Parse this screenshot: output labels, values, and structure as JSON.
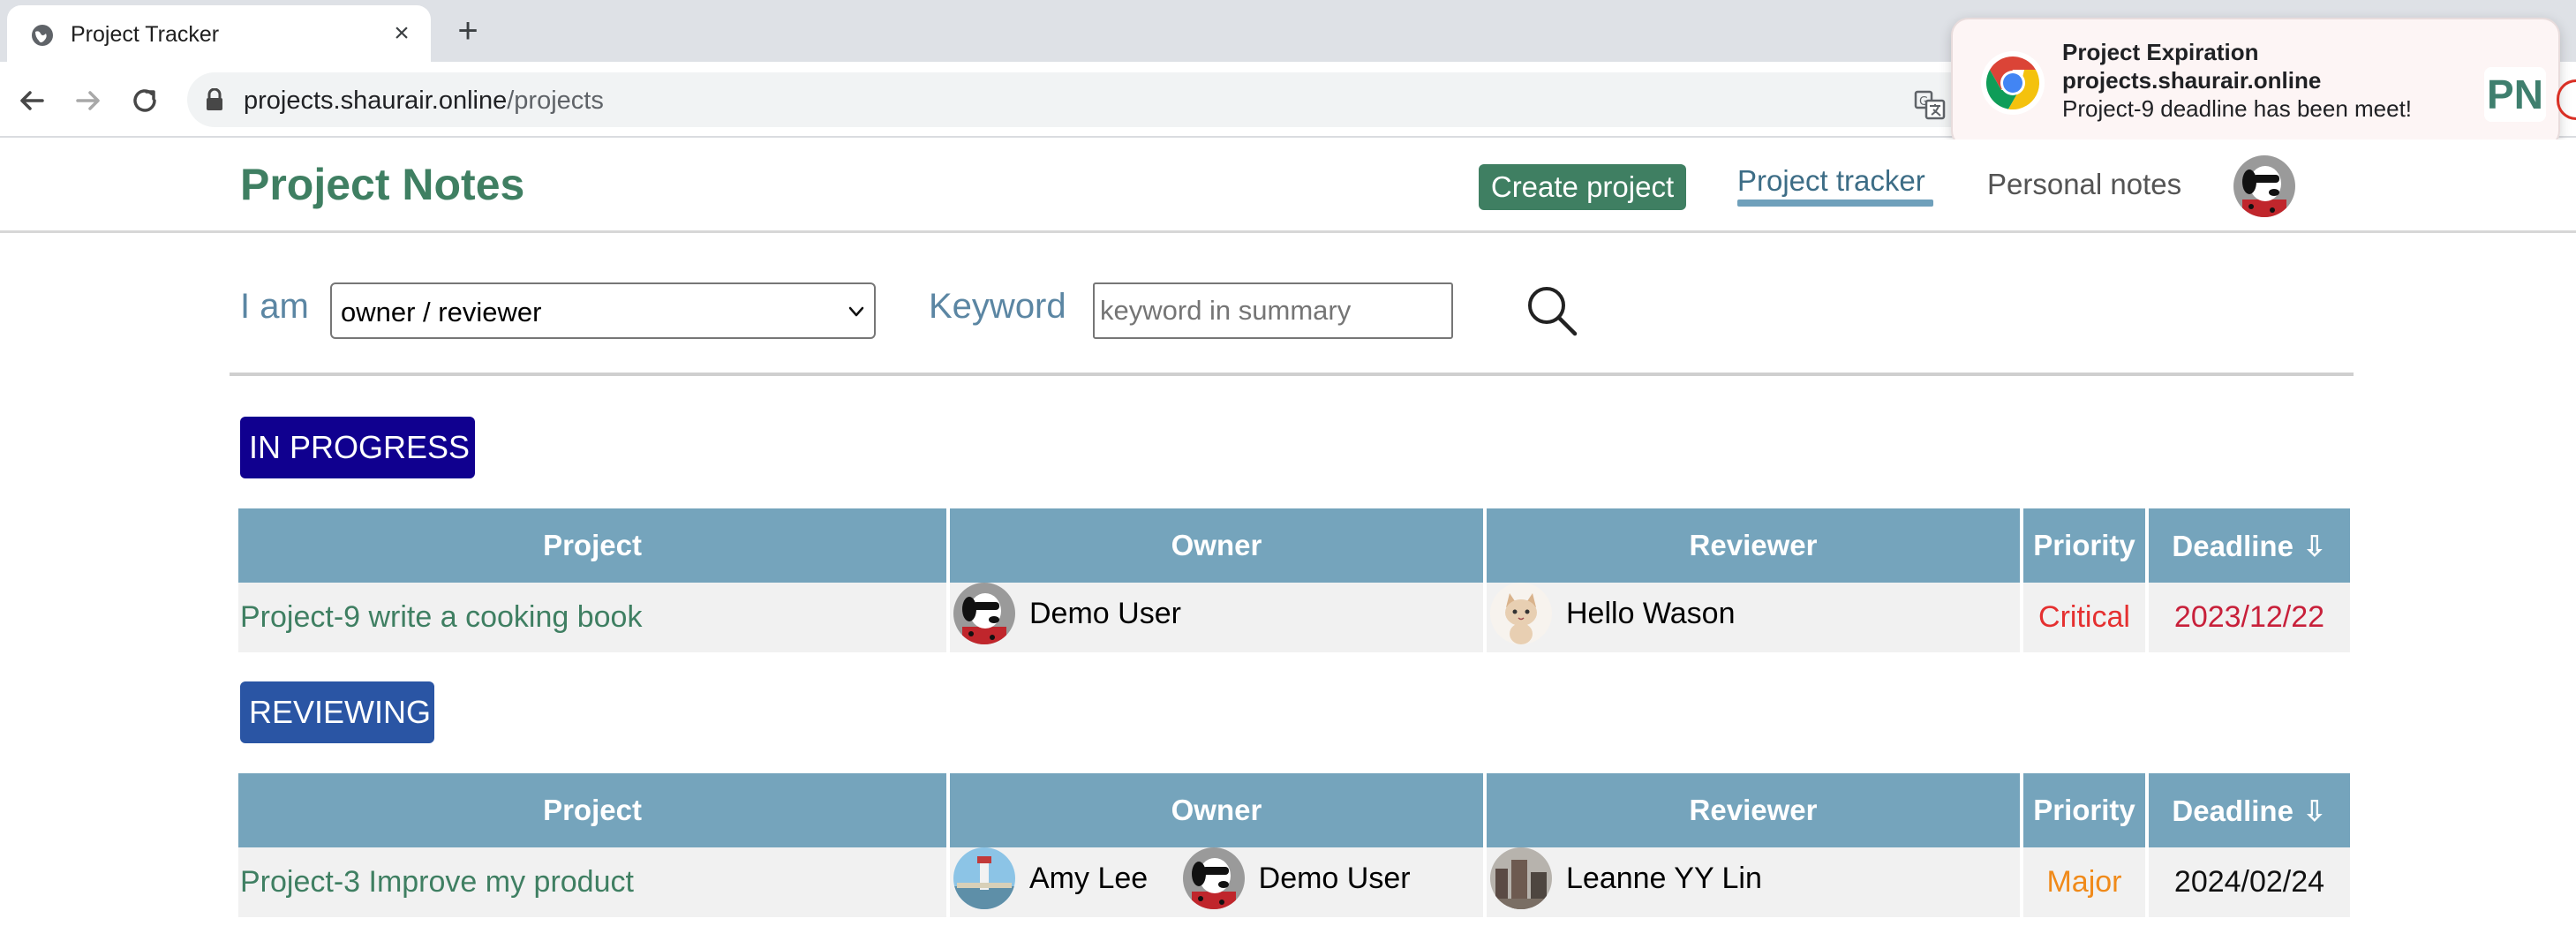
{
  "browser": {
    "tab_title": "Project Tracker",
    "tab_close_glyph": "×",
    "new_tab_glyph": "+",
    "url_host": "projects.shaurair.online",
    "url_path": "/projects"
  },
  "notification": {
    "title": "Project Expiration",
    "site": "projects.shaurair.online",
    "message": "Project-9 deadline has been meet!",
    "badge": "PN"
  },
  "header": {
    "brand": "Project Notes",
    "create_button": "Create project",
    "nav": [
      {
        "label": "Project tracker",
        "active": true
      },
      {
        "label": "Personal notes",
        "active": false
      }
    ]
  },
  "filters": {
    "role_label": "I am",
    "role_value": "owner / reviewer",
    "keyword_label": "Keyword",
    "keyword_placeholder": "keyword in summary",
    "keyword_value": ""
  },
  "columns": {
    "project": "Project",
    "owner": "Owner",
    "reviewer": "Reviewer",
    "priority": "Priority",
    "deadline": "Deadline",
    "sort_glyph": "⇩"
  },
  "sections": [
    {
      "status": "IN PROGRESS",
      "rows": [
        {
          "project": "Project-9 write a cooking book",
          "owners": [
            {
              "name": "Demo User",
              "avatar": "snoopy"
            }
          ],
          "reviewers": [
            {
              "name": "Hello Wason",
              "avatar": "cat"
            }
          ],
          "priority": "Critical",
          "deadline": "2023/12/22"
        }
      ]
    },
    {
      "status": "REVIEWING",
      "rows": [
        {
          "project": "Project-3 Improve my product",
          "owners": [
            {
              "name": "Amy Lee",
              "avatar": "lighthouse"
            },
            {
              "name": "Demo User",
              "avatar": "snoopy"
            }
          ],
          "reviewers": [
            {
              "name": "Leanne YY Lin",
              "avatar": "city"
            }
          ],
          "priority": "Major",
          "deadline": "2024/02/24"
        }
      ]
    }
  ],
  "colors": {
    "brand_green": "#3f7f62",
    "table_header": "#75a4bc",
    "in_progress": "#10008f",
    "reviewing": "#2a55a4",
    "critical": "#e53030",
    "major": "#f08a1a"
  }
}
